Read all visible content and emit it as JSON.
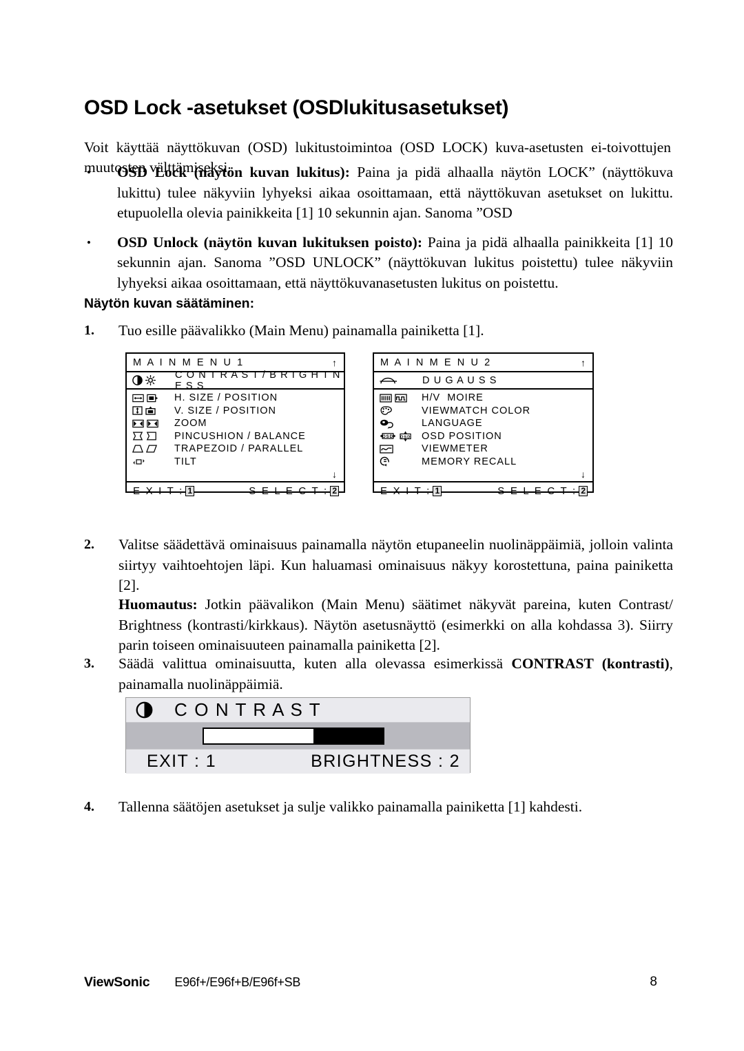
{
  "document": {
    "title": "OSD Lock -asetukset (OSDlukitusasetukset)",
    "intro": "Voit käyttää näyttökuvan (OSD) lukitustoimintoa (OSD LOCK) kuva-asetusten ei-toivottujen muutosten välttämiseksi.",
    "bullets": [
      {
        "marker": "•",
        "bold": "OSD Lock (näytön kuvan lukitus):",
        "text": " Paina ja pidä alhaalla näytön LOCK” (näyttökuva lukittu) tulee näkyviin lyhyeksi aikaa osoittamaan, että näyttökuvan asetukset on lukittu. etupuolella olevia painikkeita [1] 10 sekunnin ajan. Sanoma ”OSD"
      },
      {
        "marker": "•",
        "bold": "OSD Unlock (näytön kuvan lukituksen poisto):",
        "text": " Paina ja pidä alhaalla painikkeita [1] 10 sekunnin ajan. Sanoma ”OSD UNLOCK” (näyttökuvan lukitus poistettu) tulee näkyviin lyhyeksi aikaa osoittamaan, että näyttökuvanasetusten lukitus on poistettu."
      }
    ],
    "subheading": "Näytön kuvan säätäminen:",
    "steps": {
      "step1_num": "1.",
      "step1_text": "Tuo esille päävalikko (Main Menu) painamalla painiketta [1].",
      "step2_num": "2.",
      "step2_text": "Valitse säädettävä ominaisuus painamalla näytön etupaneelin nuolinäppäimiä, jolloin valinta siirtyy vaihtoehtojen läpi. Kun haluamasi ominaisuus näkyy korostettuna, paina painiketta [2].",
      "note_bold": "Huomautus:",
      "note_text": " Jotkin päävalikon (Main Menu) säätimet näkyvät pareina, kuten Contrast/ Brightness (kontrasti/kirkkaus). Näytön asetusnäyttö (esimerkki on alla kohdassa 3). Siirry parin toiseen ominaisuuteen painamalla painiketta [2].",
      "step3_num": "3.",
      "step3_pre": "Säädä valittua ominaisuutta, kuten alla olevassa esimerkissä ",
      "step3_bold": "CONTRAST (kontrasti)",
      "step3_post": ", painamalla nuolinäppäimiä.",
      "step4_num": "4.",
      "step4_text": "Tallenna säätöjen asetukset ja sulje valikko painamalla painiketta [1] kahdesti."
    }
  },
  "osd_menu_1": {
    "title": "M A I N   M E N U  1",
    "scroll_up": "↑",
    "scroll_down": "↓",
    "highlighted": {
      "label": "C O N T R A S T / B R I G H T N E S S",
      "icons": [
        "contrast-icon",
        "brightness-icon"
      ]
    },
    "rows": [
      {
        "label": "H. SIZE / POSITION",
        "icons": [
          "h-size-icon",
          "h-position-icon"
        ]
      },
      {
        "label": "V. SIZE / POSITION",
        "icons": [
          "v-size-icon",
          "v-position-icon"
        ]
      },
      {
        "label": "ZOOM",
        "icons": [
          "zoom-out-icon",
          "zoom-in-icon"
        ]
      },
      {
        "label": "PINCUSHION / BALANCE",
        "icons": [
          "pincushion-icon",
          "balance-icon"
        ]
      },
      {
        "label": "TRAPEZOID / PARALLEL",
        "icons": [
          "trapezoid-icon",
          "parallelogram-icon"
        ]
      },
      {
        "label": "TILT",
        "icons": [
          "tilt-icon"
        ]
      }
    ],
    "footer": {
      "exit_label": "E X I T  :",
      "exit_key": "1",
      "select_label": "S E L E C T  :",
      "select_key": "2"
    }
  },
  "osd_menu_2": {
    "title": "M A I N   M E N U  2",
    "scroll_up": "↑",
    "scroll_down": "↓",
    "highlighted": {
      "label": "D U G A U S S",
      "icons": [
        "degauss-icon"
      ]
    },
    "rows": [
      {
        "label": "H/V  MOIRE",
        "icons": [
          "h-moire-icon",
          "v-moire-icon"
        ]
      },
      {
        "label": "VIEWMATCH COLOR",
        "icons": [
          "palette-icon"
        ]
      },
      {
        "label": "LANGUAGE",
        "icons": [
          "speech-bubble-icon"
        ]
      },
      {
        "label": "OSD POSITION",
        "icons": [
          "osd-h-position-icon",
          "osd-v-position-icon"
        ]
      },
      {
        "label": "VIEWMETER",
        "icons": [
          "viewmeter-icon"
        ]
      },
      {
        "label": "MEMORY RECALL",
        "icons": [
          "memory-recall-icon"
        ]
      }
    ],
    "footer": {
      "exit_label": "E X I T  :",
      "exit_key": "1",
      "select_label": "S E L E C T  :",
      "select_key": "2"
    }
  },
  "contrast_box": {
    "icon": "contrast-icon",
    "title": "C O N T R A S T",
    "slider_percent": 62,
    "exit_label": "EXIT : 1",
    "brightness_label": "BRIGHTNESS : 2"
  },
  "footer": {
    "brand": "ViewSonic",
    "model": "E96f+/E96f+B/E96f+SB",
    "page_number": "8"
  },
  "colors": {
    "ink": "#000000",
    "osd_light": "#eaeaee",
    "osd_mid": "#b9b9bf",
    "key_bg": "#e0e0e0"
  }
}
